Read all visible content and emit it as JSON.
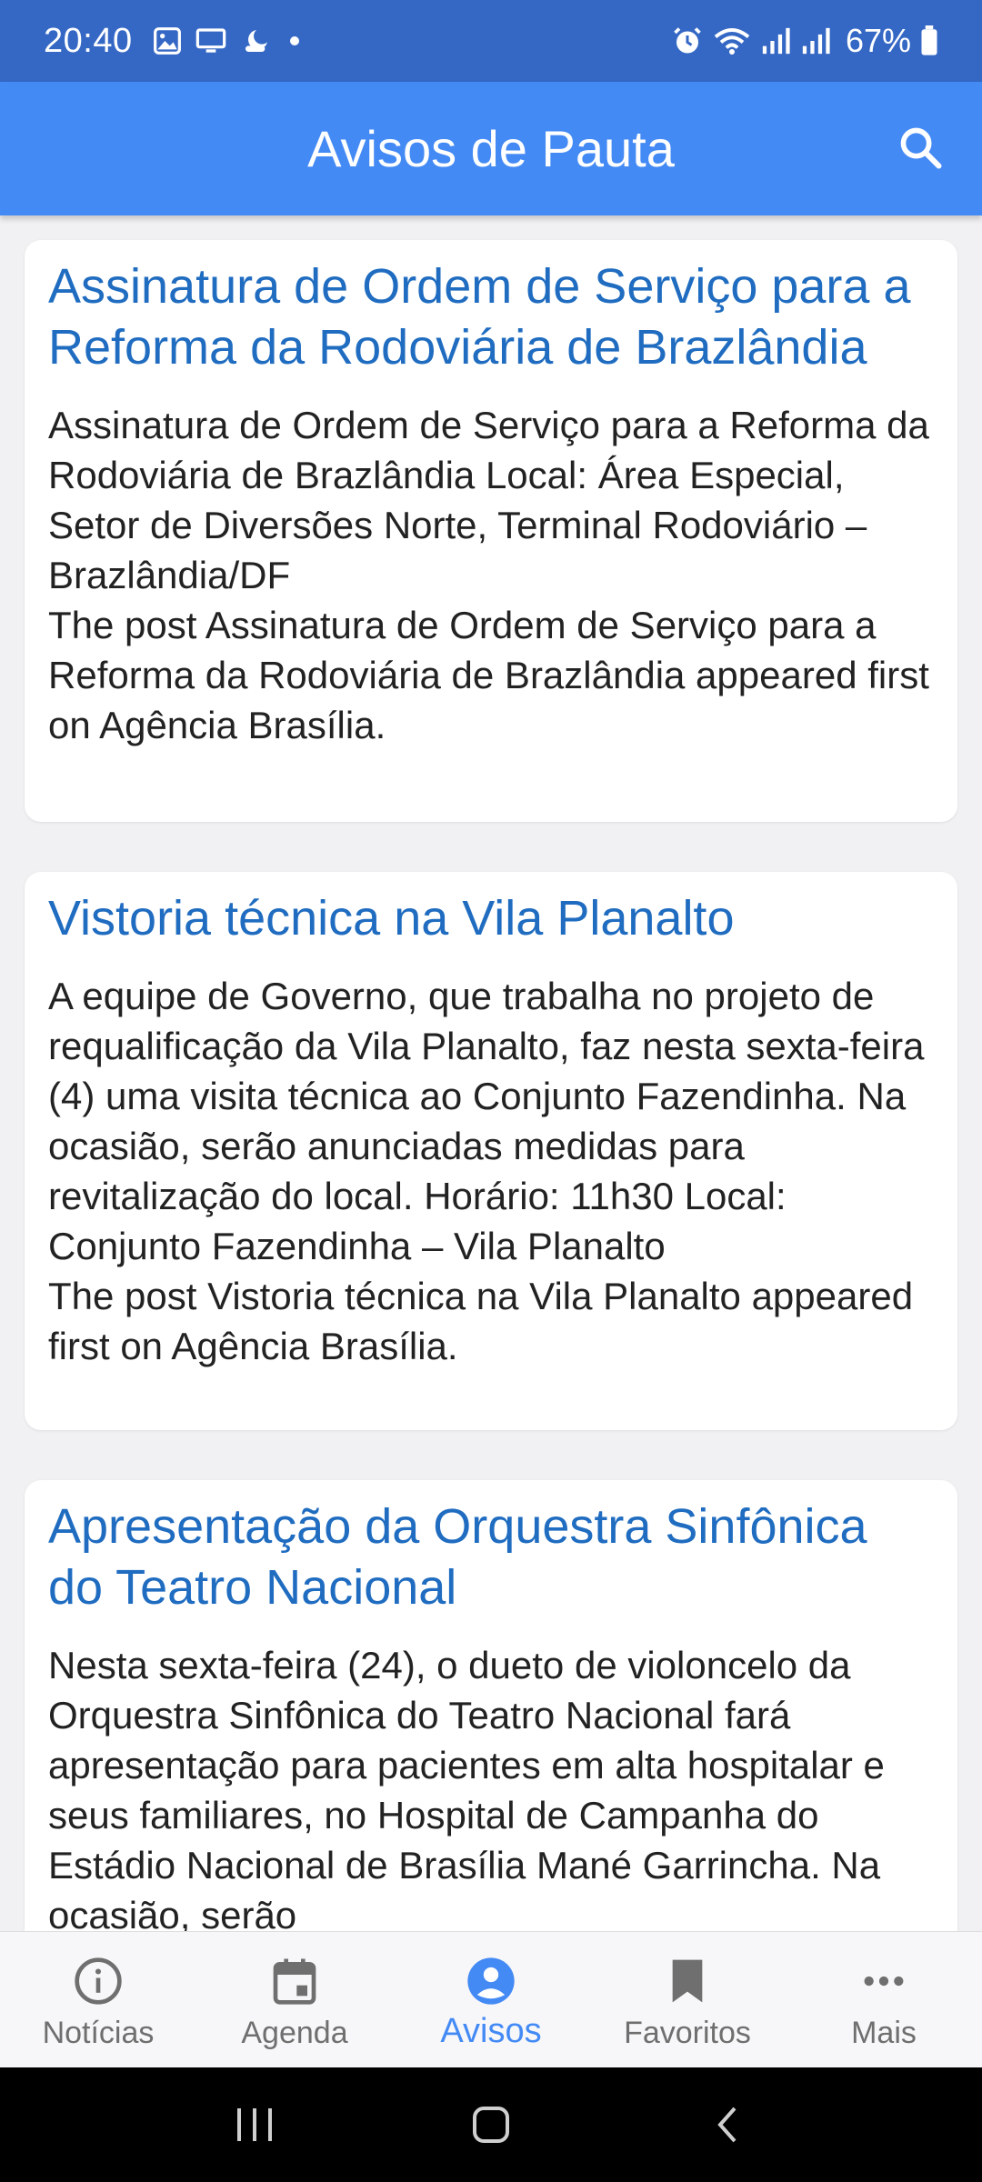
{
  "status_bar": {
    "time": "20:40",
    "battery_pct": "67%",
    "left_icons": [
      "image-icon",
      "monitor-icon",
      "moon-cloud-icon",
      "dot-icon"
    ],
    "right_icons": [
      "alarm-icon",
      "wifi-icon",
      "signal-icon",
      "signal-icon",
      "battery-icon"
    ]
  },
  "app_bar": {
    "title": "Avisos de Pauta",
    "search_icon": "search-icon"
  },
  "colors": {
    "status_bar": "#3568c5",
    "app_bar": "#448af5",
    "card_title": "#1f6cc0",
    "active_nav": "#448af5"
  },
  "cards": [
    {
      "title": "Assinatura de Ordem de Serviço para a Reforma da Rodoviária de Brazlândia",
      "body": "Assinatura de Ordem de Serviço para a Reforma da Rodoviária de Brazlândia Local: Área Especial, Setor de Diversões Norte, Terminal Rodoviário – Brazlândia/DF\nThe post Assinatura de Ordem de Serviço para a Reforma da Rodoviária de Brazlândia appeared first on Agência Brasília."
    },
    {
      "title": "Vistoria técnica na Vila Planalto",
      "body": "A equipe de Governo, que trabalha no projeto de requalificação da Vila Planalto, faz nesta sexta-feira (4) uma visita técnica ao Conjunto Fazendinha. Na ocasião, serão anunciadas medidas para revitalização do local. Horário: 11h30 Local: Conjunto Fazendinha – Vila Planalto\nThe post Vistoria técnica na Vila Planalto appeared first on Agência Brasília."
    },
    {
      "title": "Apresentação da Orquestra Sinfônica do Teatro Nacional",
      "body": "Nesta sexta-feira (24), o dueto de violoncelo da Orquestra Sinfônica do Teatro Nacional fará apresentação para pacientes em alta hospitalar e seus familiares, no Hospital de Campanha do Estádio Nacional de Brasília Mané Garrincha. Na ocasião, serão"
    }
  ],
  "bottom_nav": [
    {
      "label": "Notícias",
      "icon": "info-icon",
      "active": false
    },
    {
      "label": "Agenda",
      "icon": "calendar-icon",
      "active": false
    },
    {
      "label": "Avisos",
      "icon": "person-icon",
      "active": true
    },
    {
      "label": "Favoritos",
      "icon": "bookmark-icon",
      "active": false
    },
    {
      "label": "Mais",
      "icon": "more-horizontal-icon",
      "active": false
    }
  ],
  "system_nav": [
    "recents-icon",
    "home-icon",
    "back-icon"
  ]
}
